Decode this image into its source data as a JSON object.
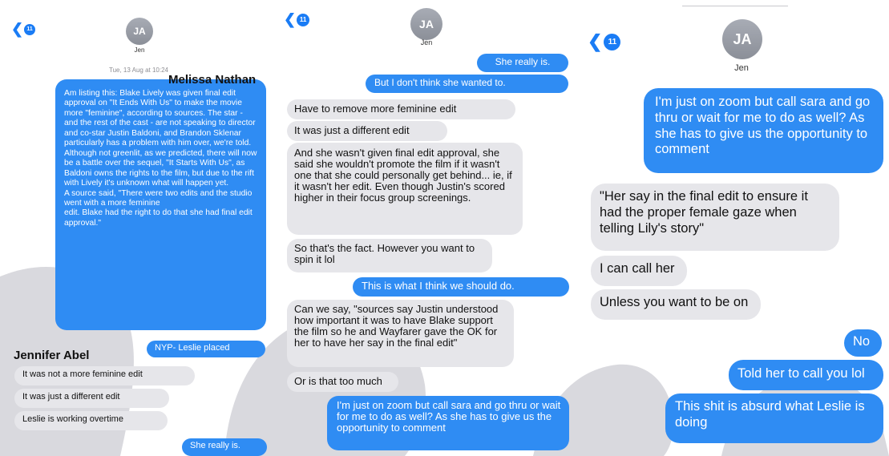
{
  "contact": {
    "initials": "JA",
    "name": "Jen",
    "unread": "11"
  },
  "watermark_color": "#d9d9de",
  "accent": "#2f8cf3",
  "panel1": {
    "timestamp": "Tue, 13 Aug at 10:24",
    "overlay_label_top": "Melissa Nathan",
    "overlay_label_bottom": "Jennifer Abel",
    "messages": [
      {
        "dir": "out",
        "text": "Am listing this: Blake Lively was given final edit approval on \"It Ends With Us\" to make the movie more \"feminine\", according to sources. The star - and the rest of the cast - are not speaking to director and co-star Justin Baldoni, and Brandon Sklenar particularly has a problem with him over, we're told. Although not greenlit, as we predicted, there will now be a battle over the sequel, \"It Starts With Us\", as Baldoni owns the rights to the film, but due to the rift with Lively it's unknown what will happen yet.\nA source said, \"There were two edits and the studio went with a more feminine\nedit. Blake had the right to do that she had final edit approval.\""
      },
      {
        "dir": "out",
        "text": "NYP- Leslie placed"
      },
      {
        "dir": "in",
        "text": "It was not a more feminine edit"
      },
      {
        "dir": "in",
        "text": "It was just a different edit"
      },
      {
        "dir": "in",
        "text": "Leslie is working overtime"
      },
      {
        "dir": "out",
        "text": "She really is."
      }
    ]
  },
  "panel2": {
    "messages": [
      {
        "dir": "out",
        "text": "She really is."
      },
      {
        "dir": "out",
        "text": "But I don't think she wanted to."
      },
      {
        "dir": "in",
        "text": "Have to remove more feminine edit"
      },
      {
        "dir": "in",
        "text": "It was just a different edit"
      },
      {
        "dir": "in",
        "text": "And she wasn't given final edit approval, she said she wouldn't promote the film if it wasn't one that she could personally get behind... ie, if it wasn't her edit.  Even though Justin's scored higher in their focus group screenings."
      },
      {
        "dir": "in",
        "text": "So that's the fact. However you want to spin it lol"
      },
      {
        "dir": "out",
        "text": "This is what I think we should do."
      },
      {
        "dir": "in",
        "text": "Can we say, \"sources say Justin understood how important it was to have Blake support the film so he and Wayfarer gave the OK for her to have her say in the final edit\""
      },
      {
        "dir": "in",
        "text": "Or is that too much"
      },
      {
        "dir": "out",
        "text": "I'm just on zoom but call sara and go thru or wait for me to do as well? As she has to give us the opportunity to comment"
      }
    ]
  },
  "panel3": {
    "messages": [
      {
        "dir": "out",
        "text": "I'm just on zoom but call sara and go thru or wait for me to do as well? As she has to give us the opportunity to comment"
      },
      {
        "dir": "in",
        "text": "\"Her say in the final edit to ensure it had the proper female gaze when telling Lily's story\""
      },
      {
        "dir": "in",
        "text": "I can call her"
      },
      {
        "dir": "in",
        "text": "Unless you want to be on"
      },
      {
        "dir": "out",
        "text": "No"
      },
      {
        "dir": "out",
        "text": "Told her to call you lol"
      },
      {
        "dir": "out",
        "text": "This shit is absurd what Leslie is doing"
      }
    ]
  }
}
